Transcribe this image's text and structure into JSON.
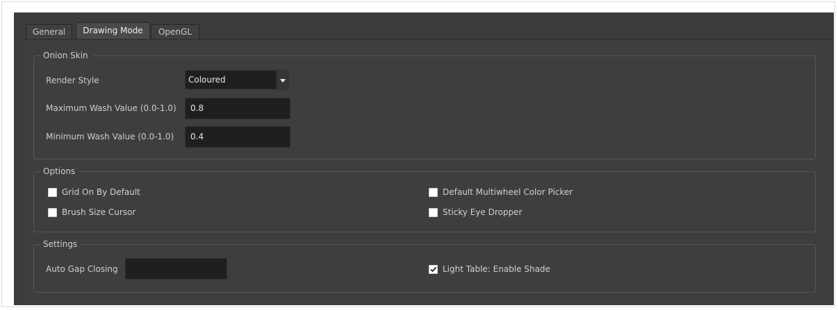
{
  "tabs": [
    {
      "label": "General"
    },
    {
      "label": "Drawing Mode"
    },
    {
      "label": "OpenGL"
    }
  ],
  "active_tab": "Drawing Mode",
  "onion_skin": {
    "title": "Onion Skin",
    "render_style_label": "Render Style",
    "render_style_value": "Coloured",
    "max_wash_label": "Maximum Wash Value (0.0-1.0)",
    "max_wash_value": "0.8",
    "min_wash_label": "Minimum Wash Value (0.0-1.0)",
    "min_wash_value": "0.4"
  },
  "options": {
    "title": "Options",
    "grid_on_label": "Grid On By Default",
    "grid_on_checked": false,
    "brush_size_label": "Brush Size Cursor",
    "brush_size_checked": false,
    "multiwheel_label": "Default Multiwheel Color Picker",
    "multiwheel_checked": false,
    "sticky_eye_label": "Sticky Eye Dropper",
    "sticky_eye_checked": false
  },
  "settings": {
    "title": "Settings",
    "auto_gap_label": "Auto Gap Closing",
    "auto_gap_value": "",
    "light_table_label": "Light Table: Enable Shade",
    "light_table_checked": true
  },
  "colors": {
    "panel_bg": "#3c3c3c",
    "field_bg": "#1f1f1f",
    "checkbox_bg": "#ffffff"
  }
}
